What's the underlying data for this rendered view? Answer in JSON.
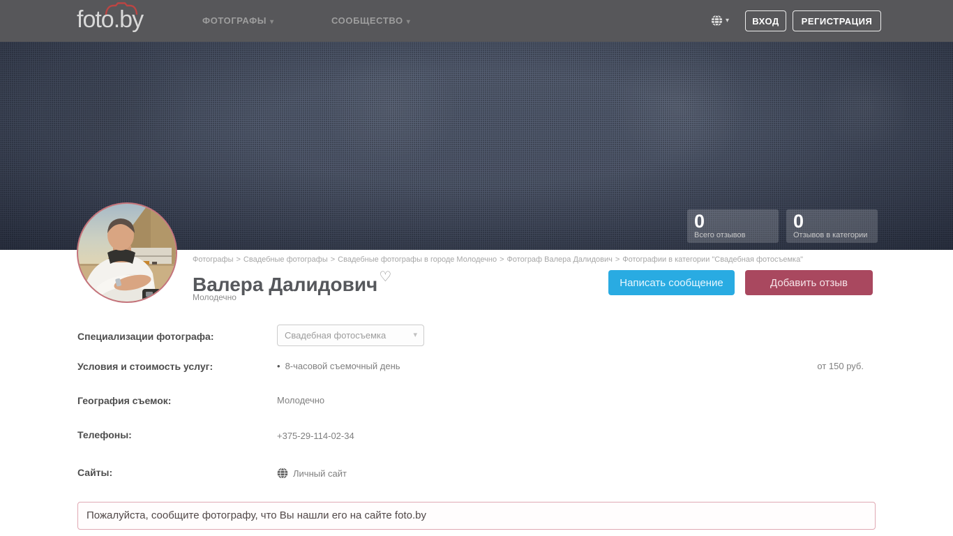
{
  "navbar": {
    "logo": "foto.by",
    "menu": [
      {
        "label": "ФОТОГРАФЫ"
      },
      {
        "label": "СООБЩЕСТВО"
      }
    ],
    "login_label": "ВХОД",
    "register_label": "РЕГИСТРАЦИЯ"
  },
  "icons": {
    "caret_down": "▾",
    "heart_outline": "♡",
    "bullet": "•"
  },
  "hero": {
    "stats": [
      {
        "value": "0",
        "label": "Всего отзывов"
      },
      {
        "value": "0",
        "label": "Отзывов в категории"
      }
    ]
  },
  "profile": {
    "breadcrumb": {
      "separator": ">",
      "items": [
        "Фотографы",
        "Свадебные фотографы",
        "Свадебные фотографы в городе Молодечно",
        "Фотограф Валера Далидович",
        "Фотографии в категории \"Свадебная фотосъемка\""
      ]
    },
    "name": "Валера Далидович",
    "city": "Молодечно",
    "message_button": "Написать сообщение",
    "review_button": "Добавить отзыв"
  },
  "details": {
    "rows": [
      {
        "label": "Специализации фотографа:",
        "value": "Свадебная фотосъемка"
      },
      {
        "label": "Условия и стоимость услуг:",
        "value": "8-часовой съемочный день",
        "price": "от 150 руб."
      },
      {
        "label": "География съемок:",
        "value": "Молодечно"
      },
      {
        "label": "Телефоны:",
        "value": "+375-29-114-02-34"
      },
      {
        "label": "Сайты:",
        "value": "Личный сайт"
      }
    ]
  },
  "notice": {
    "text": "Пожалуйста, сообщите фотографу, что Вы нашли его на сайте foto.by"
  },
  "colors": {
    "navbar_bg": "#57575a",
    "hero_base": "#4a5468",
    "accent_blue": "#29abe2",
    "accent_maroon": "#a9485f",
    "brand_red": "#bc4543",
    "alert_border": "#e0a9b3"
  }
}
